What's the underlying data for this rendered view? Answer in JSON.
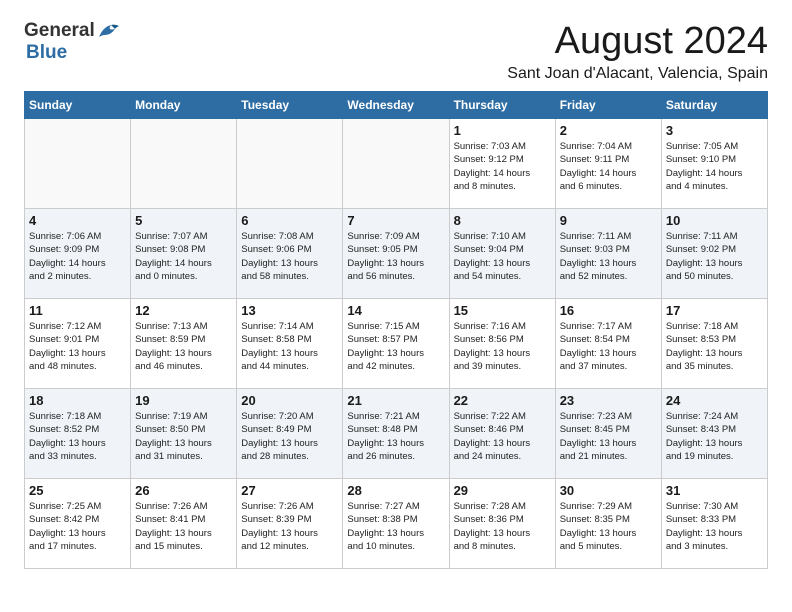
{
  "header": {
    "logo_general": "General",
    "logo_blue": "Blue",
    "month_title": "August 2024",
    "location": "Sant Joan d'Alacant, Valencia, Spain"
  },
  "days_of_week": [
    "Sunday",
    "Monday",
    "Tuesday",
    "Wednesday",
    "Thursday",
    "Friday",
    "Saturday"
  ],
  "weeks": [
    [
      {
        "day": "",
        "info": ""
      },
      {
        "day": "",
        "info": ""
      },
      {
        "day": "",
        "info": ""
      },
      {
        "day": "",
        "info": ""
      },
      {
        "day": "1",
        "info": "Sunrise: 7:03 AM\nSunset: 9:12 PM\nDaylight: 14 hours\nand 8 minutes."
      },
      {
        "day": "2",
        "info": "Sunrise: 7:04 AM\nSunset: 9:11 PM\nDaylight: 14 hours\nand 6 minutes."
      },
      {
        "day": "3",
        "info": "Sunrise: 7:05 AM\nSunset: 9:10 PM\nDaylight: 14 hours\nand 4 minutes."
      }
    ],
    [
      {
        "day": "4",
        "info": "Sunrise: 7:06 AM\nSunset: 9:09 PM\nDaylight: 14 hours\nand 2 minutes."
      },
      {
        "day": "5",
        "info": "Sunrise: 7:07 AM\nSunset: 9:08 PM\nDaylight: 14 hours\nand 0 minutes."
      },
      {
        "day": "6",
        "info": "Sunrise: 7:08 AM\nSunset: 9:06 PM\nDaylight: 13 hours\nand 58 minutes."
      },
      {
        "day": "7",
        "info": "Sunrise: 7:09 AM\nSunset: 9:05 PM\nDaylight: 13 hours\nand 56 minutes."
      },
      {
        "day": "8",
        "info": "Sunrise: 7:10 AM\nSunset: 9:04 PM\nDaylight: 13 hours\nand 54 minutes."
      },
      {
        "day": "9",
        "info": "Sunrise: 7:11 AM\nSunset: 9:03 PM\nDaylight: 13 hours\nand 52 minutes."
      },
      {
        "day": "10",
        "info": "Sunrise: 7:11 AM\nSunset: 9:02 PM\nDaylight: 13 hours\nand 50 minutes."
      }
    ],
    [
      {
        "day": "11",
        "info": "Sunrise: 7:12 AM\nSunset: 9:01 PM\nDaylight: 13 hours\nand 48 minutes."
      },
      {
        "day": "12",
        "info": "Sunrise: 7:13 AM\nSunset: 8:59 PM\nDaylight: 13 hours\nand 46 minutes."
      },
      {
        "day": "13",
        "info": "Sunrise: 7:14 AM\nSunset: 8:58 PM\nDaylight: 13 hours\nand 44 minutes."
      },
      {
        "day": "14",
        "info": "Sunrise: 7:15 AM\nSunset: 8:57 PM\nDaylight: 13 hours\nand 42 minutes."
      },
      {
        "day": "15",
        "info": "Sunrise: 7:16 AM\nSunset: 8:56 PM\nDaylight: 13 hours\nand 39 minutes."
      },
      {
        "day": "16",
        "info": "Sunrise: 7:17 AM\nSunset: 8:54 PM\nDaylight: 13 hours\nand 37 minutes."
      },
      {
        "day": "17",
        "info": "Sunrise: 7:18 AM\nSunset: 8:53 PM\nDaylight: 13 hours\nand 35 minutes."
      }
    ],
    [
      {
        "day": "18",
        "info": "Sunrise: 7:18 AM\nSunset: 8:52 PM\nDaylight: 13 hours\nand 33 minutes."
      },
      {
        "day": "19",
        "info": "Sunrise: 7:19 AM\nSunset: 8:50 PM\nDaylight: 13 hours\nand 31 minutes."
      },
      {
        "day": "20",
        "info": "Sunrise: 7:20 AM\nSunset: 8:49 PM\nDaylight: 13 hours\nand 28 minutes."
      },
      {
        "day": "21",
        "info": "Sunrise: 7:21 AM\nSunset: 8:48 PM\nDaylight: 13 hours\nand 26 minutes."
      },
      {
        "day": "22",
        "info": "Sunrise: 7:22 AM\nSunset: 8:46 PM\nDaylight: 13 hours\nand 24 minutes."
      },
      {
        "day": "23",
        "info": "Sunrise: 7:23 AM\nSunset: 8:45 PM\nDaylight: 13 hours\nand 21 minutes."
      },
      {
        "day": "24",
        "info": "Sunrise: 7:24 AM\nSunset: 8:43 PM\nDaylight: 13 hours\nand 19 minutes."
      }
    ],
    [
      {
        "day": "25",
        "info": "Sunrise: 7:25 AM\nSunset: 8:42 PM\nDaylight: 13 hours\nand 17 minutes."
      },
      {
        "day": "26",
        "info": "Sunrise: 7:26 AM\nSunset: 8:41 PM\nDaylight: 13 hours\nand 15 minutes."
      },
      {
        "day": "27",
        "info": "Sunrise: 7:26 AM\nSunset: 8:39 PM\nDaylight: 13 hours\nand 12 minutes."
      },
      {
        "day": "28",
        "info": "Sunrise: 7:27 AM\nSunset: 8:38 PM\nDaylight: 13 hours\nand 10 minutes."
      },
      {
        "day": "29",
        "info": "Sunrise: 7:28 AM\nSunset: 8:36 PM\nDaylight: 13 hours\nand 8 minutes."
      },
      {
        "day": "30",
        "info": "Sunrise: 7:29 AM\nSunset: 8:35 PM\nDaylight: 13 hours\nand 5 minutes."
      },
      {
        "day": "31",
        "info": "Sunrise: 7:30 AM\nSunset: 8:33 PM\nDaylight: 13 hours\nand 3 minutes."
      }
    ]
  ]
}
